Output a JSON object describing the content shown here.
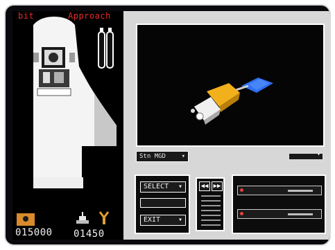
{
  "hud": {
    "mode_left": "bit",
    "mode_right": "Approach",
    "score_left": "015000",
    "score_right": "01450"
  },
  "viewport": {
    "camera_select": "Stn MGD",
    "camera_arrow": "▾"
  },
  "controls": {
    "select_label": "SELECT",
    "exit_label": "EXIT",
    "dropdown_arrow": "▾",
    "rewind_glyph": "◀◀",
    "forward_glyph": "▶▶"
  },
  "sliders": [
    {
      "value": 0.6
    },
    {
      "value": 0.6
    }
  ],
  "colors": {
    "hud_red": "#e52a2a",
    "satellite_gold": "#f2b01c",
    "solar_panel_blue": "#2f6ff0",
    "background": "#000000"
  }
}
